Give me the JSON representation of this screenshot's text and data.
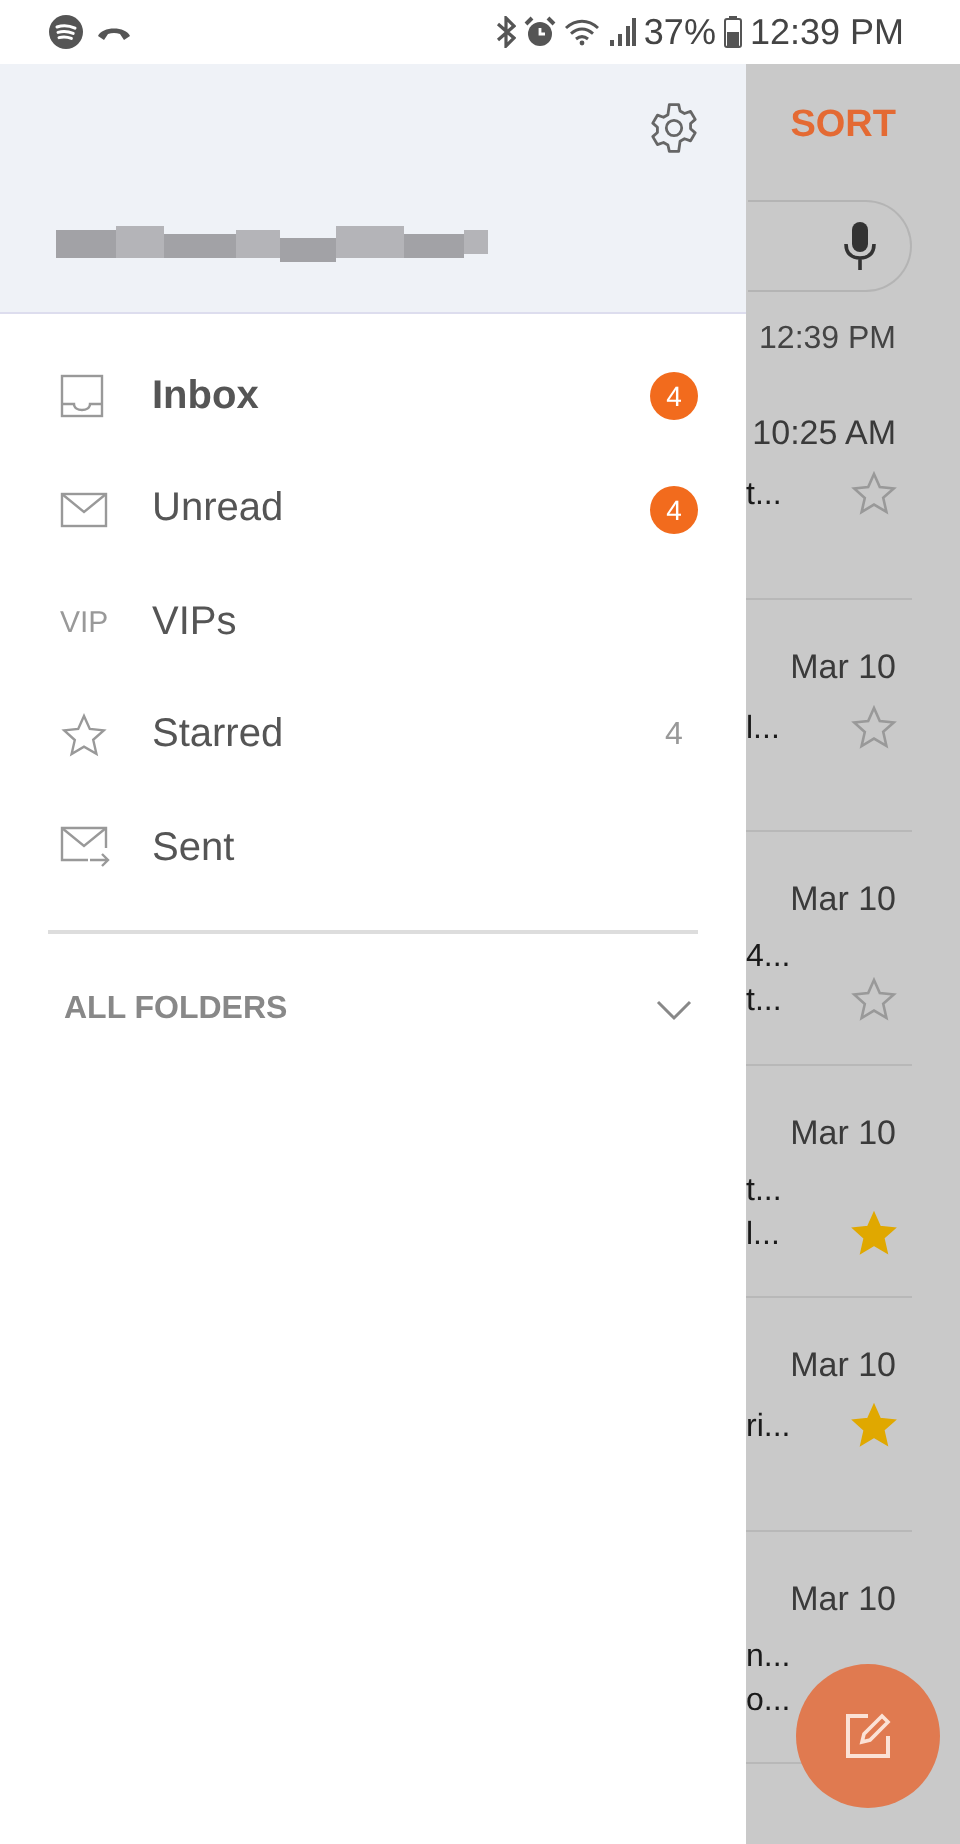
{
  "status_bar": {
    "battery": "37%",
    "time": "12:39 PM"
  },
  "background": {
    "sort_label": "SORT",
    "first_time": "12:39 PM",
    "rows": [
      {
        "time": "10:25 AM",
        "lines": [
          "t..."
        ],
        "starred": false
      },
      {
        "time": "Mar 10",
        "lines": [
          "l..."
        ],
        "starred": false
      },
      {
        "time": "Mar 10",
        "lines": [
          "4...",
          "t..."
        ],
        "starred": false
      },
      {
        "time": "Mar 10",
        "lines": [
          "t...",
          "l..."
        ],
        "starred": true
      },
      {
        "time": "Mar 10",
        "lines": [
          "ri..."
        ],
        "starred": true
      },
      {
        "time": "Mar 10",
        "lines": [
          "n...",
          "o..."
        ]
      }
    ]
  },
  "drawer": {
    "items": [
      {
        "kind": "inbox",
        "label": "Inbox",
        "selected": true,
        "badge": "4"
      },
      {
        "kind": "unread",
        "label": "Unread",
        "selected": false,
        "badge": "4"
      },
      {
        "kind": "vip",
        "icon_text": "VIP",
        "label": "VIPs",
        "selected": false
      },
      {
        "kind": "starred",
        "label": "Starred",
        "selected": false,
        "count": "4"
      },
      {
        "kind": "sent",
        "label": "Sent",
        "selected": false
      }
    ],
    "all_folders": {
      "label": "ALL FOLDERS",
      "expanded": false
    }
  }
}
